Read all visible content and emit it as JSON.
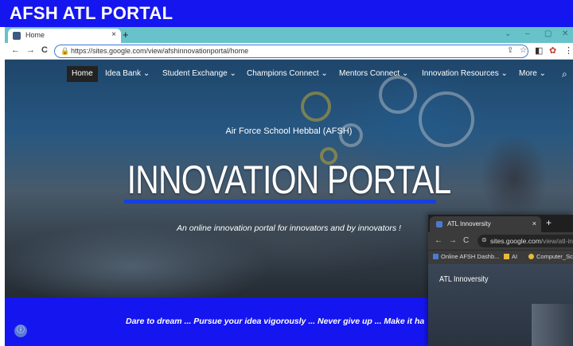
{
  "banner": {
    "title": "AFSH ATL PORTAL",
    "color": "#1515f0"
  },
  "browser": {
    "tab": {
      "title": "Home",
      "close": "×"
    },
    "new_tab": "+",
    "window_controls": [
      "⌄",
      "–",
      "▢",
      "✕"
    ],
    "nav": {
      "back": "←",
      "forward": "→",
      "reload": "C"
    },
    "url": "https://sites.google.com/view/afshinnovationportal/home"
  },
  "site": {
    "nav": [
      {
        "label": "Home",
        "active": true
      },
      {
        "label": "Idea Bank",
        "has_dropdown": true
      },
      {
        "label": "Student Exchange",
        "has_dropdown": true
      },
      {
        "label": "Champions Connect",
        "has_dropdown": true
      },
      {
        "label": "Mentors Connect",
        "has_dropdown": true
      },
      {
        "label": "Innovation Resources",
        "has_dropdown": true
      },
      {
        "label": "More",
        "has_dropdown": true
      }
    ],
    "dropdown_glyph": "⌄",
    "school": "Air Force School Hebbal (AFSH)",
    "title": "INNOVATION PORTAL",
    "tagline": "An online innovation portal for innovators and by innovators !",
    "motto": "Dare to dream ...  Pursue your idea vigorously ...  Never give up ...  Make it ha",
    "accent_color": "#1640e0"
  },
  "browser2": {
    "tab": {
      "title": "ATL Innoversity",
      "close": "×"
    },
    "new_tab": "+",
    "url_host": "sites.google.com",
    "url_path": "/view/atl-inn",
    "bookmarks": [
      {
        "label": "Online AFSH Dashb..."
      },
      {
        "label": "AI"
      },
      {
        "label": "Computer_Scie"
      }
    ],
    "site_title": "ATL Innoversity"
  }
}
